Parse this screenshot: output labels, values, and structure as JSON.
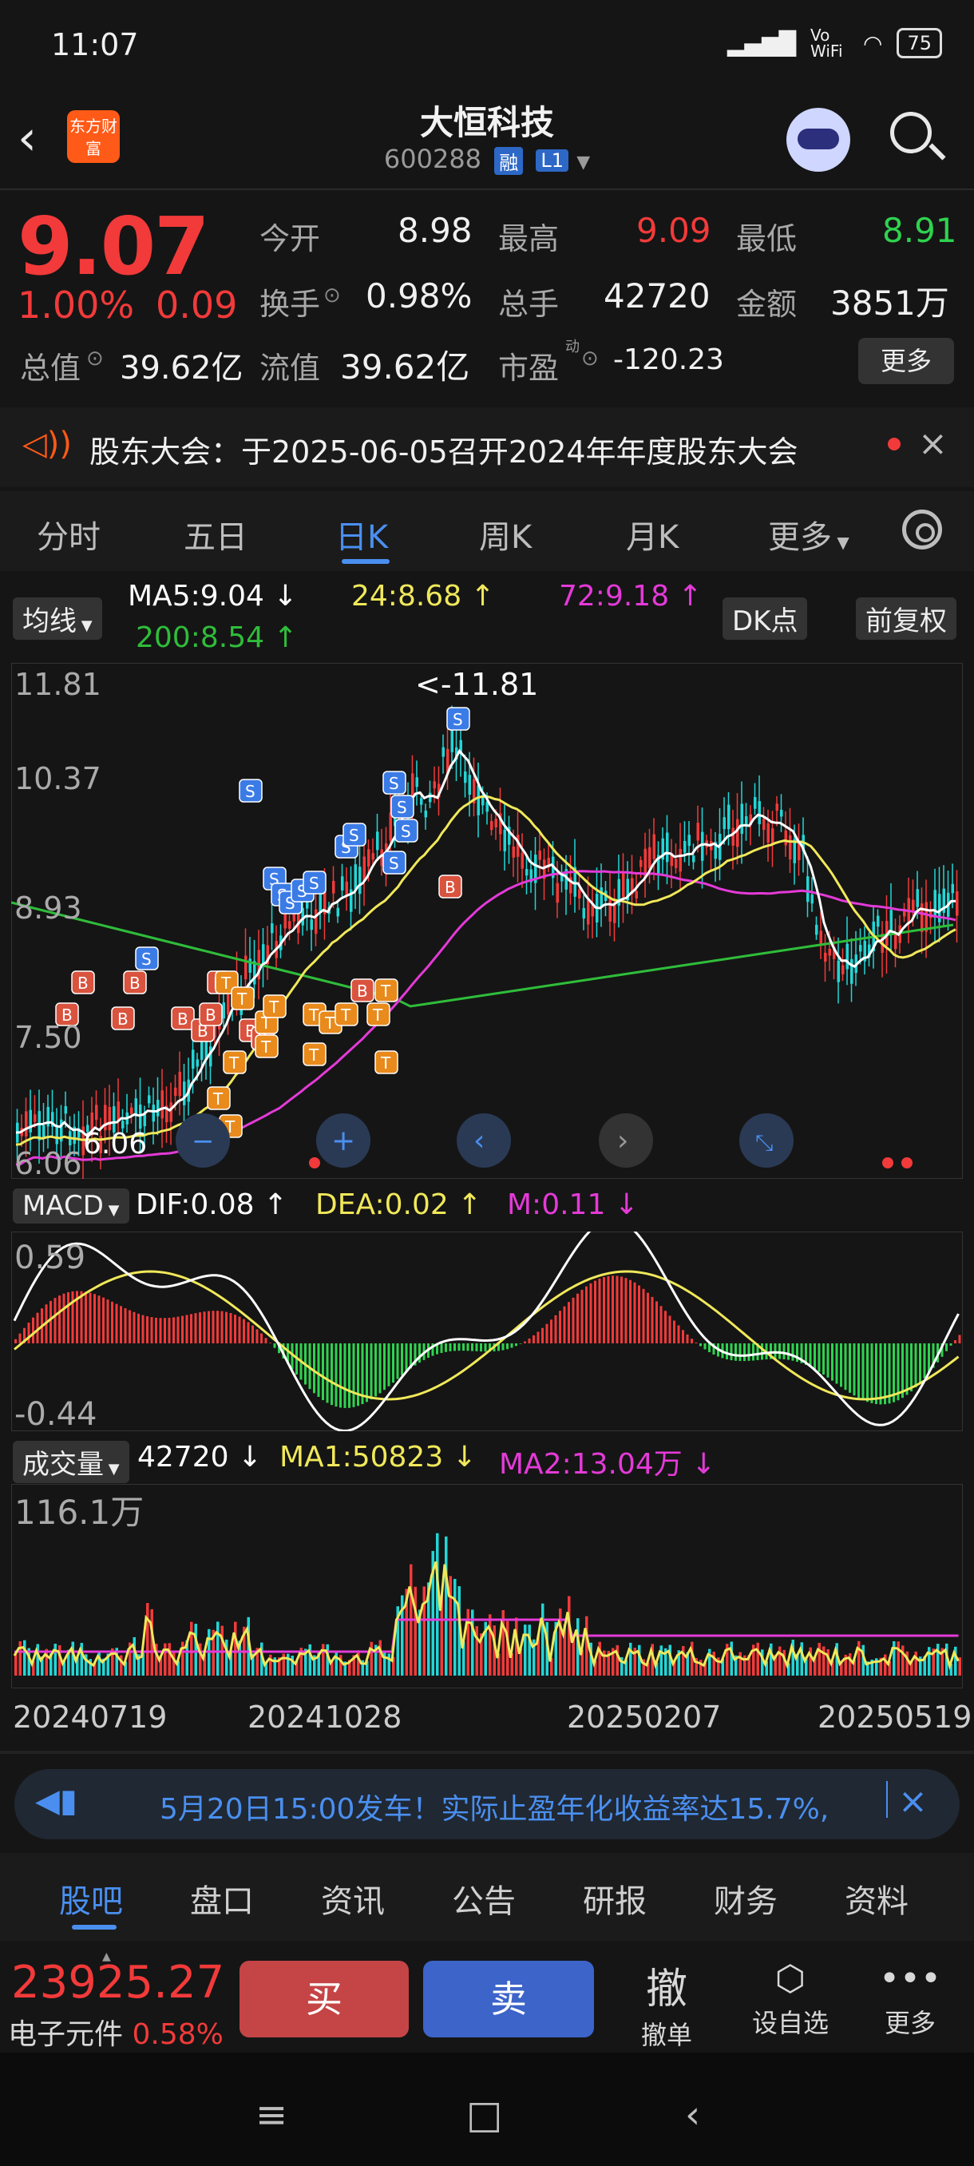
{
  "status": {
    "time": "11:07",
    "network": "Vo WiFi",
    "battery": "75"
  },
  "header": {
    "back": "‹",
    "logo": "东方财富",
    "title": "大恒科技",
    "code": "600288",
    "tag1": "融",
    "tag2": "L1"
  },
  "quote": {
    "price": "9.07",
    "pct": "1.00%",
    "change": "0.09",
    "open_label": "今开",
    "open": "8.98",
    "high_label": "最高",
    "high": "9.09",
    "low_label": "最低",
    "low": "8.91",
    "turnover_label": "换手",
    "turnover": "0.98%",
    "volume_label": "总手",
    "volume": "42720",
    "amount_label": "金额",
    "amount": "3851万",
    "mktcap_label": "总值",
    "mktcap": "39.62亿",
    "float_label": "流值",
    "float": "39.62亿",
    "pe_label": "市盈",
    "pe_sup": "动",
    "pe": "-120.23",
    "more": "更多"
  },
  "notice": {
    "text": "股东大会：于2025-06-05召开2024年年度股东大会",
    "close": "×"
  },
  "period_tabs": [
    "分时",
    "五日",
    "日K",
    "周K",
    "月K",
    "更多"
  ],
  "chart_header": {
    "ma_select": "均线",
    "ma5": "MA5:9.04",
    "ma24": "24:8.68",
    "ma72": "72:9.18",
    "ma200": "200:8.54",
    "dk": "DK点",
    "adjust": "前复权"
  },
  "colors": {
    "up": "#f23a3a",
    "down": "#23d6d6",
    "ma5": "#ffffff",
    "ma24": "#f0e85a",
    "ma72": "#e43ad8",
    "ma200": "#2fbd3a",
    "accent": "#4a8ff0"
  },
  "price_axis": {
    "t1": "11.81",
    "t2": "10.37",
    "t3": "8.93",
    "t4": "7.50",
    "t5": "6.06"
  },
  "price_marks": {
    "high": "<-11.81",
    "low": "6.06"
  },
  "macd_header": {
    "select": "MACD",
    "dif": "DIF:0.08",
    "dea": "DEA:0.02",
    "m": "M:0.11"
  },
  "macd_axis": {
    "top": "0.59",
    "bottom": "-0.44"
  },
  "vol_header": {
    "select": "成交量",
    "vol": "42720",
    "ma1": "MA1:50823",
    "ma2": "MA2:13.04万"
  },
  "vol_axis": {
    "top": "116.1万"
  },
  "date_axis": [
    "20240719",
    "20241028",
    "20250207",
    "20250519"
  ],
  "ad": {
    "text": "5月20日15:00发车！实际止盈年化收益率达15.7%,",
    "close": "×"
  },
  "bottom_tabs": [
    "股吧",
    "盘口",
    "资讯",
    "公告",
    "研报",
    "财务",
    "资料"
  ],
  "trade": {
    "index_value": "23925.27",
    "index_name": "电子元件",
    "index_pct": "0.58%",
    "buy": "买",
    "sell": "卖",
    "cancel": "撤",
    "cancel_label": "撤单",
    "watch_label": "设自选",
    "more_label": "更多"
  },
  "nav": {
    "menu": "≡",
    "home": "□",
    "back": "‹"
  }
}
